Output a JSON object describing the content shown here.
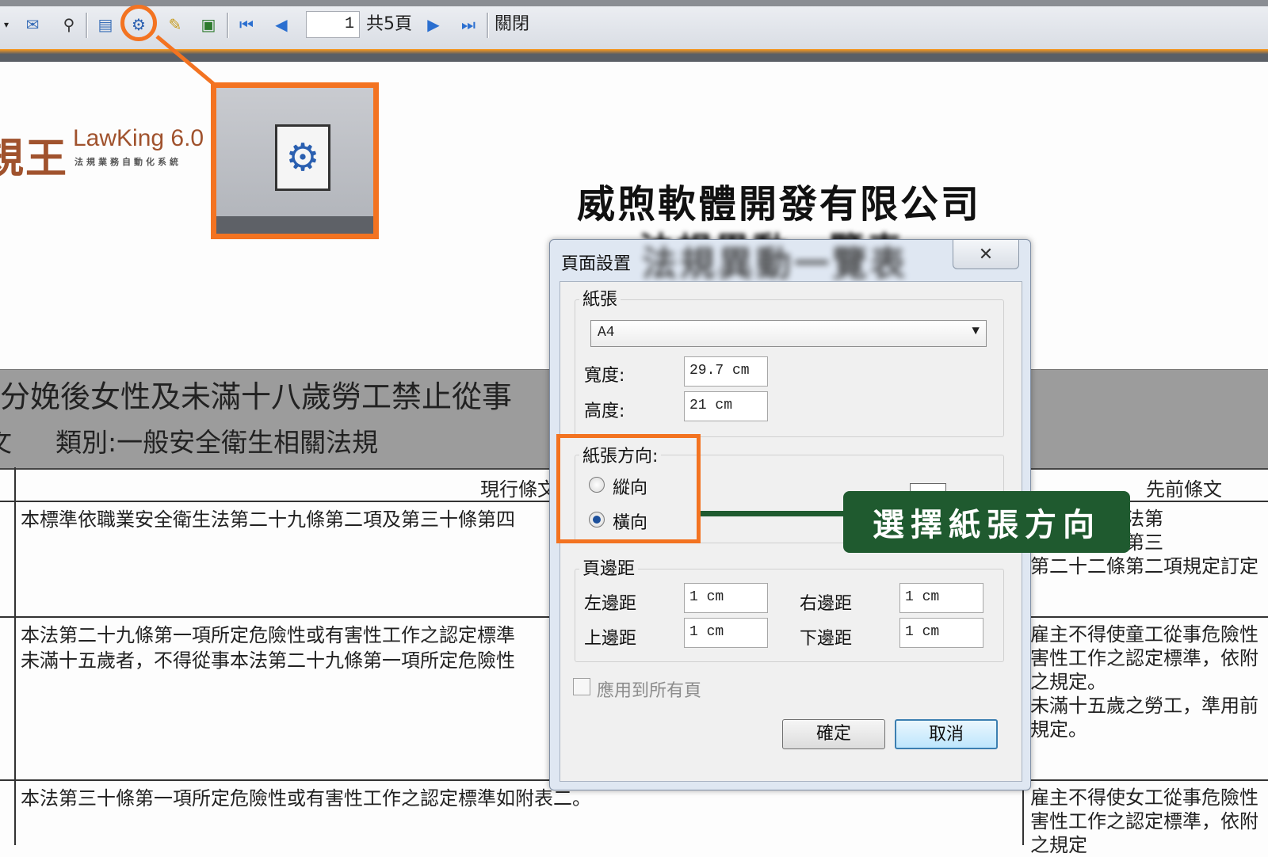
{
  "toolbar": {
    "page_value": "1",
    "total_pages": "共5頁",
    "close_label": "關閉",
    "icons": [
      "dropdown-icon",
      "mail-icon",
      "find-icon",
      "layout-icon",
      "page-setup-icon",
      "edit-icon",
      "export-icon",
      "first-page-icon",
      "prev-page-icon",
      "next-page-icon",
      "last-page-icon"
    ]
  },
  "logo": {
    "cn": "規王",
    "en": "LawKing 6.0",
    "sub": "法規業務自動化系統"
  },
  "report": {
    "company": "威煦軟體開發有限公司",
    "title_blurred": "法規異動一覽表",
    "law_title": "分娩後女性及未滿十八歲勞工禁止從事",
    "category": "類別:一般安全衛生相關法規",
    "truncated_char": "文",
    "col_current": "現行條文",
    "col_previous": "先前條文",
    "rows": [
      {
        "current": [
          "本標準依職業安全衛生法第二十九條第二項及第三十條第四"
        ],
        "previous": [
          "工安全衛生法第",
          "第二十一條第三",
          "第二十二條第二項規定訂定"
        ]
      },
      {
        "current": [
          "本法第二十九條第一項所定危險性或有害性工作之認定標準",
          "未滿十五歲者，不得從事本法第二十九條第一項所定危險性"
        ],
        "previous": [
          "雇主不得使童工從事危險性",
          "害性工作之認定標準，依附",
          "之規定。",
          "未滿十五歲之勞工，準用前",
          "規定。"
        ]
      },
      {
        "current": [
          "本法第三十條第一項所定危險性或有害性工作之認定標準如附表二。"
        ],
        "previous": [
          "雇主不得使女工從事危險性",
          "害性工作之認定標準，依附",
          "之規定"
        ]
      }
    ]
  },
  "dialog": {
    "title": "頁面設置",
    "title_blurred": "法規異動一覽表",
    "close_icon": "close-icon",
    "paper_group": "紙張",
    "paper_size": "A4",
    "width_label": "寬度:",
    "width_value": "29.7 cm",
    "height_label": "高度:",
    "height_value": "21 cm",
    "orientation_group": "紙張方向:",
    "portrait_label": "縱向",
    "landscape_label": "橫向",
    "selected_orientation": "landscape",
    "margins_group": "頁邊距",
    "left_label": "左邊距",
    "left_value": "1 cm",
    "right_label": "右邊距",
    "right_value": "1 cm",
    "top_label": "上邊距",
    "top_value": "1 cm",
    "bottom_label": "下邊距",
    "bottom_value": "1 cm",
    "apply_all_label": "應用到所有頁",
    "ok_label": "確定",
    "cancel_label": "取消"
  },
  "annotation": {
    "callout_text": "選擇紙張方向",
    "accent_color": "#f37321",
    "callout_color": "#1f5a2f"
  }
}
